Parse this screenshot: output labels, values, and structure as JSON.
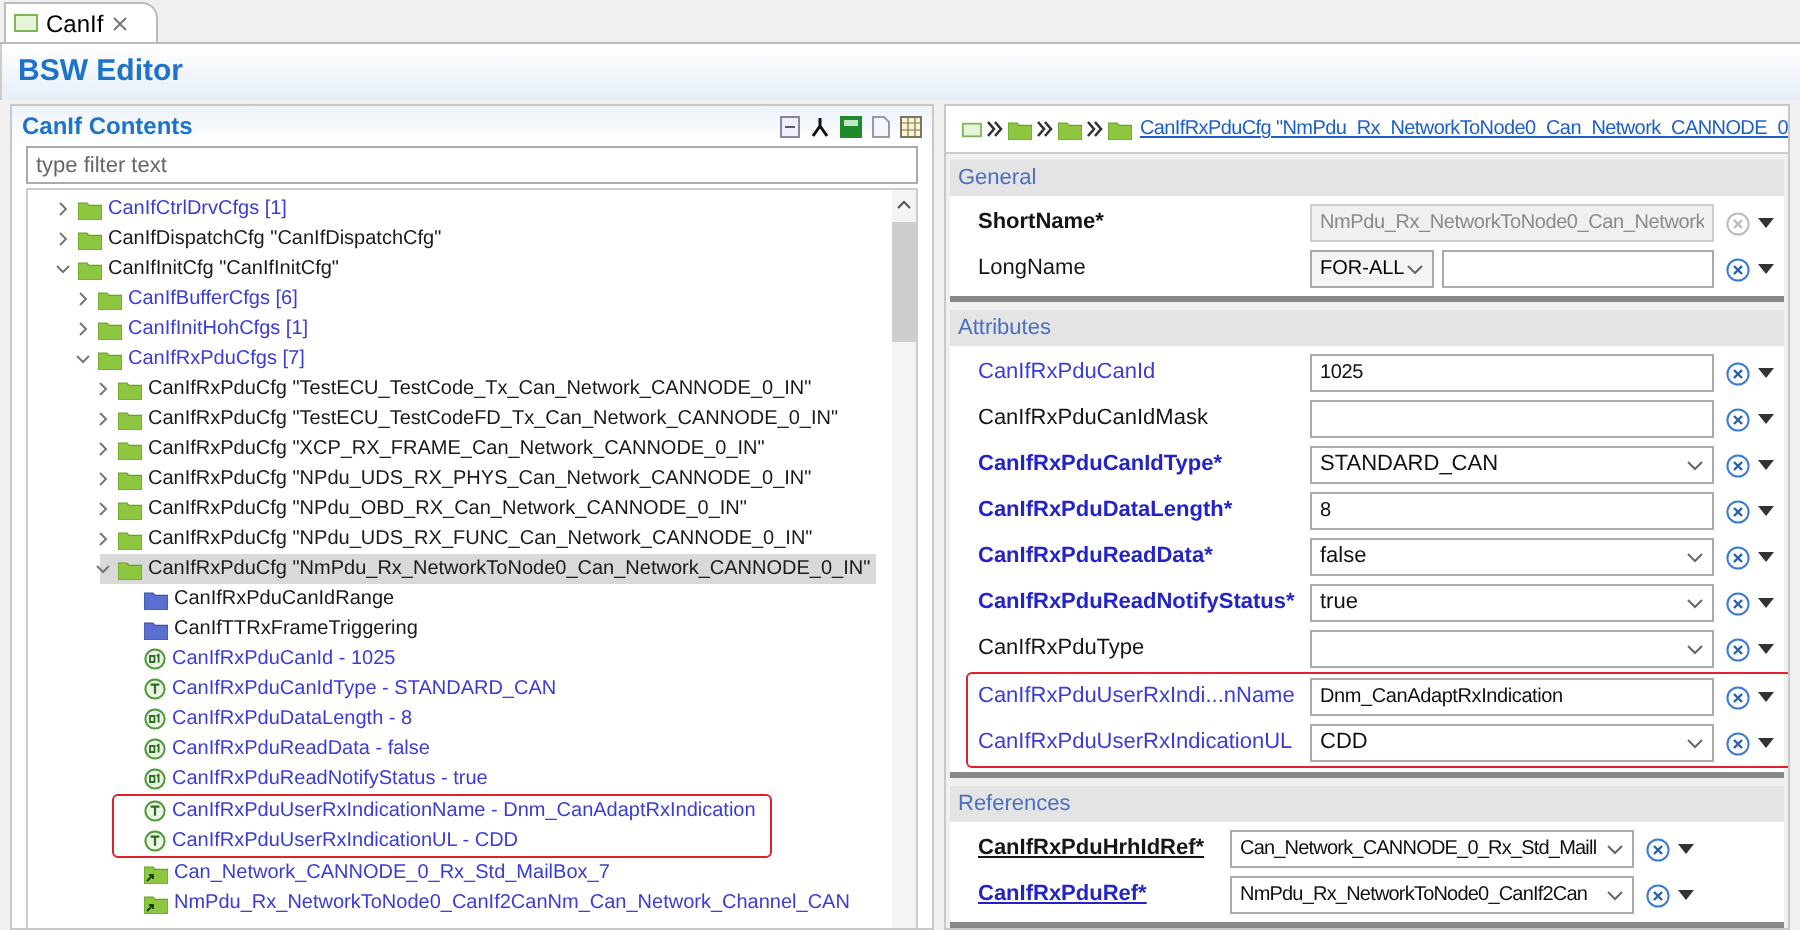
{
  "tab": {
    "label": "CanIf",
    "selected": true
  },
  "editor": {
    "title": "BSW Editor"
  },
  "contents": {
    "title": "CanIf Contents",
    "filter": {
      "placeholder": "type filter text"
    },
    "tree": [
      {
        "label": "CanIfCtrlDrvCfgs [1]",
        "kind": "list",
        "expanded": false,
        "selected": false,
        "highlighted": false
      },
      {
        "label": "CanIfDispatchCfg \"CanIfDispatchCfg\"",
        "kind": "container",
        "expanded": false,
        "selected": false,
        "highlighted": false
      },
      {
        "label": "CanIfInitCfg \"CanIfInitCfg\"",
        "kind": "container",
        "expanded": true,
        "selected": false,
        "highlighted": false,
        "children": [
          {
            "label": "CanIfBufferCfgs [6]",
            "kind": "list",
            "expanded": false,
            "selected": false,
            "highlighted": false
          },
          {
            "label": "CanIfInitHohCfgs [1]",
            "kind": "list",
            "expanded": false,
            "selected": false,
            "highlighted": false
          },
          {
            "label": "CanIfRxPduCfgs [7]",
            "kind": "list",
            "expanded": true,
            "selected": false,
            "highlighted": false,
            "children": [
              {
                "label": "CanIfRxPduCfg \"TestECU_TestCode_Tx_Can_Network_CANNODE_0_IN\"",
                "kind": "container",
                "expanded": false,
                "selected": false,
                "highlighted": false
              },
              {
                "label": "CanIfRxPduCfg \"TestECU_TestCodeFD_Tx_Can_Network_CANNODE_0_IN\"",
                "kind": "container",
                "expanded": false,
                "selected": false,
                "highlighted": false
              },
              {
                "label": "CanIfRxPduCfg \"XCP_RX_FRAME_Can_Network_CANNODE_0_IN\"",
                "kind": "container",
                "expanded": false,
                "selected": false,
                "highlighted": false
              },
              {
                "label": "CanIfRxPduCfg \"NPdu_UDS_RX_PHYS_Can_Network_CANNODE_0_IN\"",
                "kind": "container",
                "expanded": false,
                "selected": false,
                "highlighted": false
              },
              {
                "label": "CanIfRxPduCfg \"NPdu_OBD_RX_Can_Network_CANNODE_0_IN\"",
                "kind": "container",
                "expanded": false,
                "selected": false,
                "highlighted": false
              },
              {
                "label": "CanIfRxPduCfg \"NPdu_UDS_RX_FUNC_Can_Network_CANNODE_0_IN\"",
                "kind": "container",
                "expanded": false,
                "selected": false,
                "highlighted": false
              },
              {
                "label": "CanIfRxPduCfg \"NmPdu_Rx_NetworkToNode0_Can_Network_CANNODE_0_IN\"",
                "kind": "container",
                "expanded": true,
                "selected": true,
                "highlighted": false,
                "children": [
                  {
                    "label": "CanIfRxPduCanIdRange",
                    "kind": "group",
                    "selected": false,
                    "highlighted": false
                  },
                  {
                    "label": "CanIfTTRxFrameTriggering",
                    "kind": "group",
                    "selected": false,
                    "highlighted": false
                  },
                  {
                    "label": "CanIfRxPduCanId - 1025",
                    "kind": "param-value",
                    "selected": false,
                    "highlighted": false
                  },
                  {
                    "label": "CanIfRxPduCanIdType - STANDARD_CAN",
                    "kind": "param-text",
                    "selected": false,
                    "highlighted": false
                  },
                  {
                    "label": "CanIfRxPduDataLength - 8",
                    "kind": "param-value",
                    "selected": false,
                    "highlighted": false
                  },
                  {
                    "label": "CanIfRxPduReadData - false",
                    "kind": "param-value",
                    "selected": false,
                    "highlighted": false
                  },
                  {
                    "label": "CanIfRxPduReadNotifyStatus - true",
                    "kind": "param-value",
                    "selected": false,
                    "highlighted": false
                  },
                  {
                    "label": "CanIfRxPduUserRxIndicationName - Dnm_CanAdaptRxIndication",
                    "kind": "param-text",
                    "selected": false,
                    "highlighted": true
                  },
                  {
                    "label": "CanIfRxPduUserRxIndicationUL - CDD",
                    "kind": "param-text",
                    "selected": false,
                    "highlighted": true
                  },
                  {
                    "label": "Can_Network_CANNODE_0_Rx_Std_MailBox_7",
                    "kind": "ref",
                    "selected": false,
                    "highlighted": false
                  },
                  {
                    "label": "NmPdu_Rx_NetworkToNode0_CanIf2CanNm_Can_Network_Channel_CAN",
                    "kind": "ref",
                    "selected": false,
                    "highlighted": false
                  }
                ]
              }
            ]
          }
        ]
      }
    ]
  },
  "details": {
    "breadcrumb": "CanIfRxPduCfg \"NmPdu_Rx_NetworkToNode0_Can_Network_CANNODE_0",
    "sections": [
      {
        "title": "General",
        "rows": [
          {
            "label": "ShortName*",
            "required": true,
            "configured": false,
            "kind": "text",
            "value": "NmPdu_Rx_NetworkToNode0_Can_Network",
            "disabled": true,
            "highlighted": false
          },
          {
            "label": "LongName",
            "required": false,
            "configured": false,
            "kind": "lang-text",
            "language": "FOR-ALL",
            "disabled": false,
            "highlighted": false
          }
        ]
      },
      {
        "title": "Attributes",
        "rows": [
          {
            "label": "CanIfRxPduCanId",
            "required": false,
            "configured": true,
            "kind": "text",
            "value": "1025",
            "disabled": false,
            "highlighted": false
          },
          {
            "label": "CanIfRxPduCanIdMask",
            "required": false,
            "configured": false,
            "kind": "text",
            "disabled": false,
            "highlighted": false
          },
          {
            "label": "CanIfRxPduCanIdType*",
            "required": true,
            "configured": true,
            "kind": "select",
            "value": "STANDARD_CAN",
            "disabled": false,
            "highlighted": false
          },
          {
            "label": "CanIfRxPduDataLength*",
            "required": true,
            "configured": true,
            "kind": "text",
            "value": "8",
            "disabled": false,
            "highlighted": false
          },
          {
            "label": "CanIfRxPduReadData*",
            "required": true,
            "configured": true,
            "kind": "select",
            "value": "false",
            "disabled": false,
            "highlighted": false
          },
          {
            "label": "CanIfRxPduReadNotifyStatus*",
            "required": true,
            "configured": true,
            "kind": "select",
            "value": "true",
            "disabled": false,
            "highlighted": false
          },
          {
            "label": "CanIfRxPduType",
            "required": false,
            "configured": false,
            "kind": "select",
            "disabled": false,
            "highlighted": false
          },
          {
            "label": "CanIfRxPduUserRxIndi...nName",
            "required": false,
            "configured": true,
            "kind": "text",
            "value": "Dnm_CanAdaptRxIndication",
            "disabled": false,
            "highlighted": true
          },
          {
            "label": "CanIfRxPduUserRxIndicationUL",
            "required": false,
            "configured": true,
            "kind": "select",
            "value": "CDD",
            "disabled": false,
            "highlighted": true
          }
        ]
      },
      {
        "title": "References",
        "rows": [
          {
            "label": "CanIfRxPduHrhIdRef*",
            "required": true,
            "configured": false,
            "kind": "ref-select",
            "value": "Can_Network_CANNODE_0_Rx_Std_Maill",
            "disabled": false,
            "highlighted": false
          },
          {
            "label": "CanIfRxPduRef*",
            "required": true,
            "configured": true,
            "kind": "ref-select",
            "value": "NmPdu_Rx_NetworkToNode0_CanIf2Can",
            "disabled": false,
            "highlighted": false
          }
        ]
      }
    ]
  }
}
